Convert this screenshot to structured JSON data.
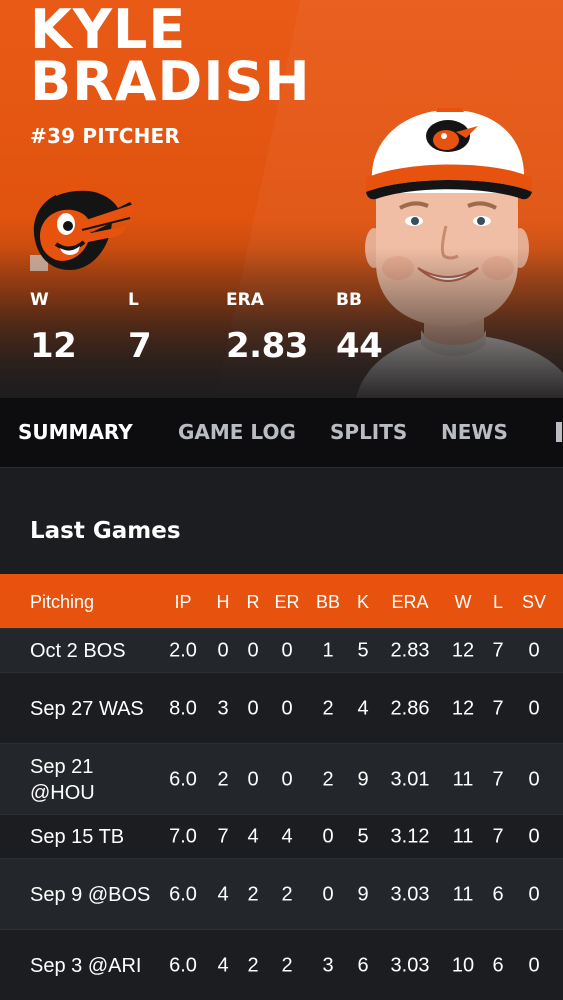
{
  "player": {
    "first_name": "KYLE",
    "last_name": "BRADISH",
    "jersey_position": "#39 PITCHER",
    "team_logo_icon": "orioles-bird-icon"
  },
  "season_stats": [
    {
      "label": "W",
      "value": "12"
    },
    {
      "label": "L",
      "value": "7"
    },
    {
      "label": "ERA",
      "value": "2.83"
    },
    {
      "label": "BB",
      "value": "44"
    }
  ],
  "tabs": [
    {
      "label": "SUMMARY",
      "active": true
    },
    {
      "label": "GAME LOG",
      "active": false
    },
    {
      "label": "SPLITS",
      "active": false
    },
    {
      "label": "NEWS",
      "active": false
    }
  ],
  "last_games": {
    "title": "Last Games",
    "columns": [
      "Pitching",
      "IP",
      "H",
      "R",
      "ER",
      "BB",
      "K",
      "ERA",
      "W",
      "L",
      "SV"
    ],
    "rows": [
      {
        "game": "Oct 2 BOS",
        "ip": "2.0",
        "h": "0",
        "r": "0",
        "er": "0",
        "bb": "1",
        "k": "5",
        "era": "2.83",
        "w": "12",
        "l": "7",
        "sv": "0"
      },
      {
        "game": "Sep 27 WAS",
        "ip": "8.0",
        "h": "3",
        "r": "0",
        "er": "0",
        "bb": "2",
        "k": "4",
        "era": "2.86",
        "w": "12",
        "l": "7",
        "sv": "0"
      },
      {
        "game": "Sep 21 @HOU",
        "ip": "6.0",
        "h": "2",
        "r": "0",
        "er": "0",
        "bb": "2",
        "k": "9",
        "era": "3.01",
        "w": "11",
        "l": "7",
        "sv": "0"
      },
      {
        "game": "Sep 15 TB",
        "ip": "7.0",
        "h": "7",
        "r": "4",
        "er": "4",
        "bb": "0",
        "k": "5",
        "era": "3.12",
        "w": "11",
        "l": "7",
        "sv": "0"
      },
      {
        "game": "Sep 9 @BOS",
        "ip": "6.0",
        "h": "4",
        "r": "2",
        "er": "2",
        "bb": "0",
        "k": "9",
        "era": "3.03",
        "w": "11",
        "l": "6",
        "sv": "0"
      },
      {
        "game": "Sep 3 @ARI",
        "ip": "6.0",
        "h": "4",
        "r": "2",
        "er": "2",
        "bb": "3",
        "k": "6",
        "era": "3.03",
        "w": "10",
        "l": "6",
        "sv": "0"
      }
    ]
  },
  "colors": {
    "accent_orange": "#e8520f",
    "tab_bar": "#0d0d0f",
    "row_alt": "#23262b",
    "background": "#1b1d21"
  }
}
